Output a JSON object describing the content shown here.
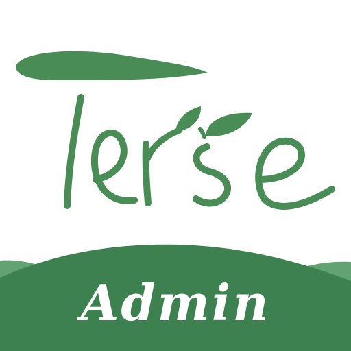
{
  "logo": {
    "wordmark": "Terse",
    "subtitle": "Admin"
  },
  "colors": {
    "brand_green": "#4a8c55",
    "banner_green": "#3d8150",
    "banner_light": "#63a271",
    "background": "#ffffff",
    "subtitle_text": "#ffffff"
  }
}
